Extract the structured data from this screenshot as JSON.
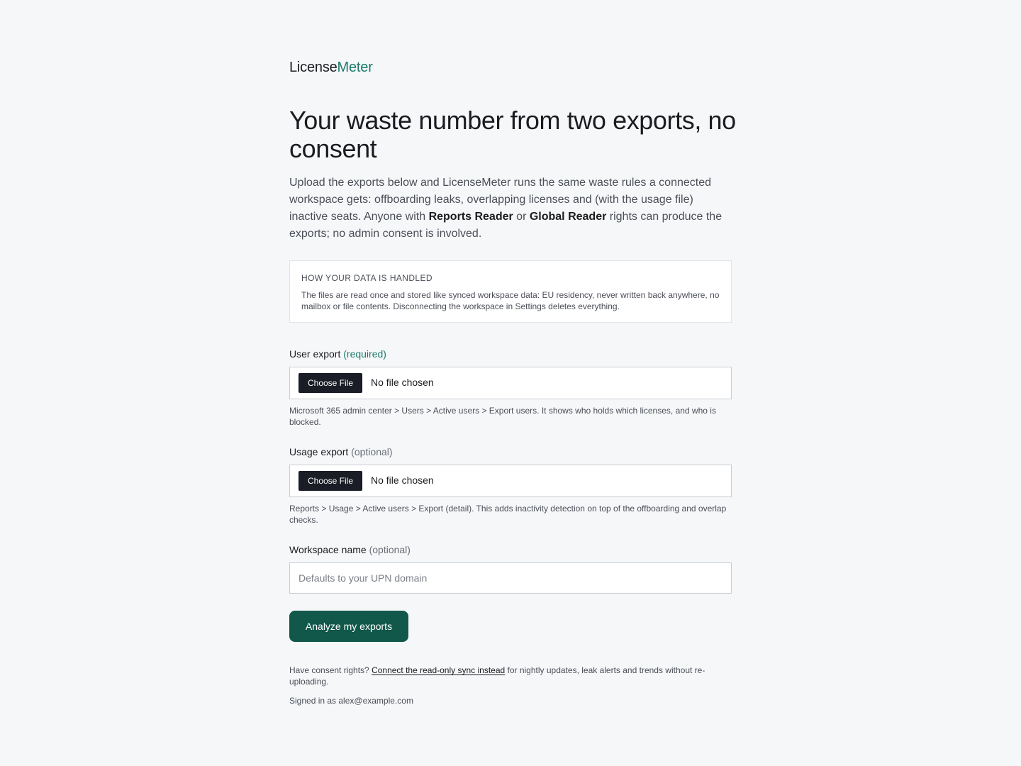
{
  "brand": {
    "name_part1": "License",
    "name_part2": "Meter",
    "accent_color": "#1a7a68"
  },
  "page": {
    "title": "Your waste number from two exports, no consent",
    "intro": {
      "part1": "Upload the exports below and LicenseMeter runs the same waste rules a connected workspace gets: offboarding leaks, overlapping licenses and (with the usage file) inactive seats. Anyone with ",
      "bold1": "Reports Reader",
      "part2": " or ",
      "bold2": "Global Reader",
      "part3": " rights can produce the exports; no admin consent is involved."
    }
  },
  "notice": {
    "heading": "HOW YOUR DATA IS HANDLED",
    "body": "The files are read once and stored like synced workspace data: EU residency, never written back anywhere, no mailbox or file contents. Disconnecting the workspace in Settings deletes everything."
  },
  "user_export": {
    "label": "User export",
    "qualifier": "(required)",
    "button_label": "Choose File",
    "status": "No file chosen",
    "help": "Microsoft 365 admin center > Users > Active users > Export users. It shows who holds which licenses, and who is blocked."
  },
  "usage_export": {
    "label": "Usage export",
    "qualifier": "(optional)",
    "button_label": "Choose File",
    "status": "No file chosen",
    "help": "Reports > Usage > Active users > Export (detail). This adds inactivity detection on top of the offboarding and overlap checks."
  },
  "workspace": {
    "label": "Workspace name",
    "qualifier": "(optional)",
    "placeholder": "Defaults to your UPN domain",
    "value": ""
  },
  "submit": {
    "label": "Analyze my exports",
    "color": "#11584b"
  },
  "footer": {
    "prefix": "Have consent rights? ",
    "link": "Connect the read-only sync instead",
    "suffix": " for nightly updates, leak alerts and trends without re-uploading.",
    "signed_in": "Signed in as alex@example.com"
  }
}
